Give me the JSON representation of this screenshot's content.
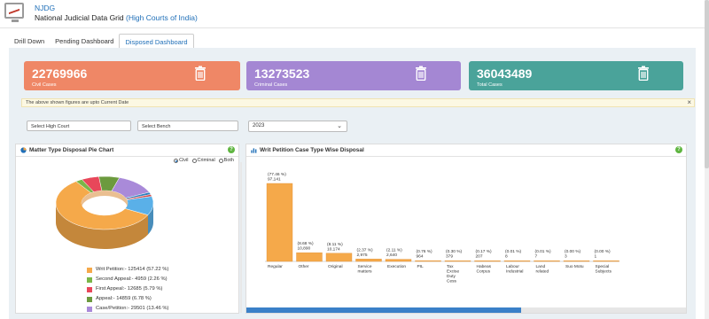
{
  "header": {
    "brand": "NJDG",
    "subtitle_prefix": "National Judicial Data Grid",
    "subtitle_highlight": "(High Courts of India)"
  },
  "tabs": [
    {
      "label": "Drill Down"
    },
    {
      "label": "Pending Dashboard"
    },
    {
      "label": "Disposed Dashboard"
    }
  ],
  "cards": [
    {
      "value": "22769966",
      "label": "Civil Cases",
      "color": "#ef8766"
    },
    {
      "value": "13273523",
      "label": "Criminal Cases",
      "color": "#a487d3"
    },
    {
      "value": "36043489",
      "label": "Total Cases",
      "color": "#4aa39a"
    }
  ],
  "notice": "The above shown figures are upto Current Date",
  "filters": {
    "high_court": "Select High Court",
    "bench": "Select Bench",
    "year": "2023"
  },
  "pie_panel": {
    "title": "Matter Type Disposal Pie Chart",
    "radios": [
      "Civil",
      "Criminal",
      "Both"
    ],
    "selected": "Civil"
  },
  "bar_panel": {
    "title": "Writ Petition Case Type Wise Disposal"
  },
  "chart_data": [
    {
      "type": "pie",
      "style": "3d-donut",
      "slices": [
        {
          "label": "Writ Petition:- 125414 (57.22 %)",
          "value": 125414,
          "color": "#f5a94a"
        },
        {
          "label": "Second Appeal:- 4959 (2.26 %)",
          "value": 4959,
          "color": "#7ab648"
        },
        {
          "label": "First Appeal:- 12685 (5.79 %)",
          "value": 12685,
          "color": "#e8475a"
        },
        {
          "label": "Appeal:- 14859 (6.78 %)",
          "value": 14859,
          "color": "#6c9a3e"
        },
        {
          "label": "Case/Petition:- 29501 (13.46 %)",
          "value": 29501,
          "color": "#a98ad9"
        }
      ],
      "other_slices": [
        {
          "value": 3000,
          "color": "#2e7fbf"
        },
        {
          "value": 2600,
          "color": "#d14a4a"
        },
        {
          "value": 25000,
          "color": "#5ab0e8"
        }
      ]
    },
    {
      "type": "bar",
      "categories": [
        "Regular",
        "Other",
        "Original",
        "Service matters",
        "Execution",
        "PIL",
        "Tax Excise Duty Cess",
        "Habeas Corpus",
        "Labour Industrial",
        "Land related",
        "Suo Motu",
        "Special Subjects"
      ],
      "values": [
        97141,
        10890,
        10174,
        2975,
        2640,
        964,
        379,
        207,
        8,
        7,
        3,
        1
      ],
      "percent_labels": [
        "(77.46 %)",
        "(8.68 %)",
        "(8.11 %)",
        "(2.37 %)",
        "(2.11 %)",
        "(0.76 %)",
        "(0.30 %)",
        "(0.17 %)",
        "(0.01 %)",
        "(0.01 %)",
        "(0.00 %)",
        "(0.00 %)"
      ],
      "value_labels": [
        "97,141",
        "10,890",
        "10,174",
        "2,975",
        "2,640",
        "964",
        "379",
        "207",
        "8",
        "7",
        "3",
        "1"
      ],
      "bar_color": "#f5a94a"
    }
  ]
}
